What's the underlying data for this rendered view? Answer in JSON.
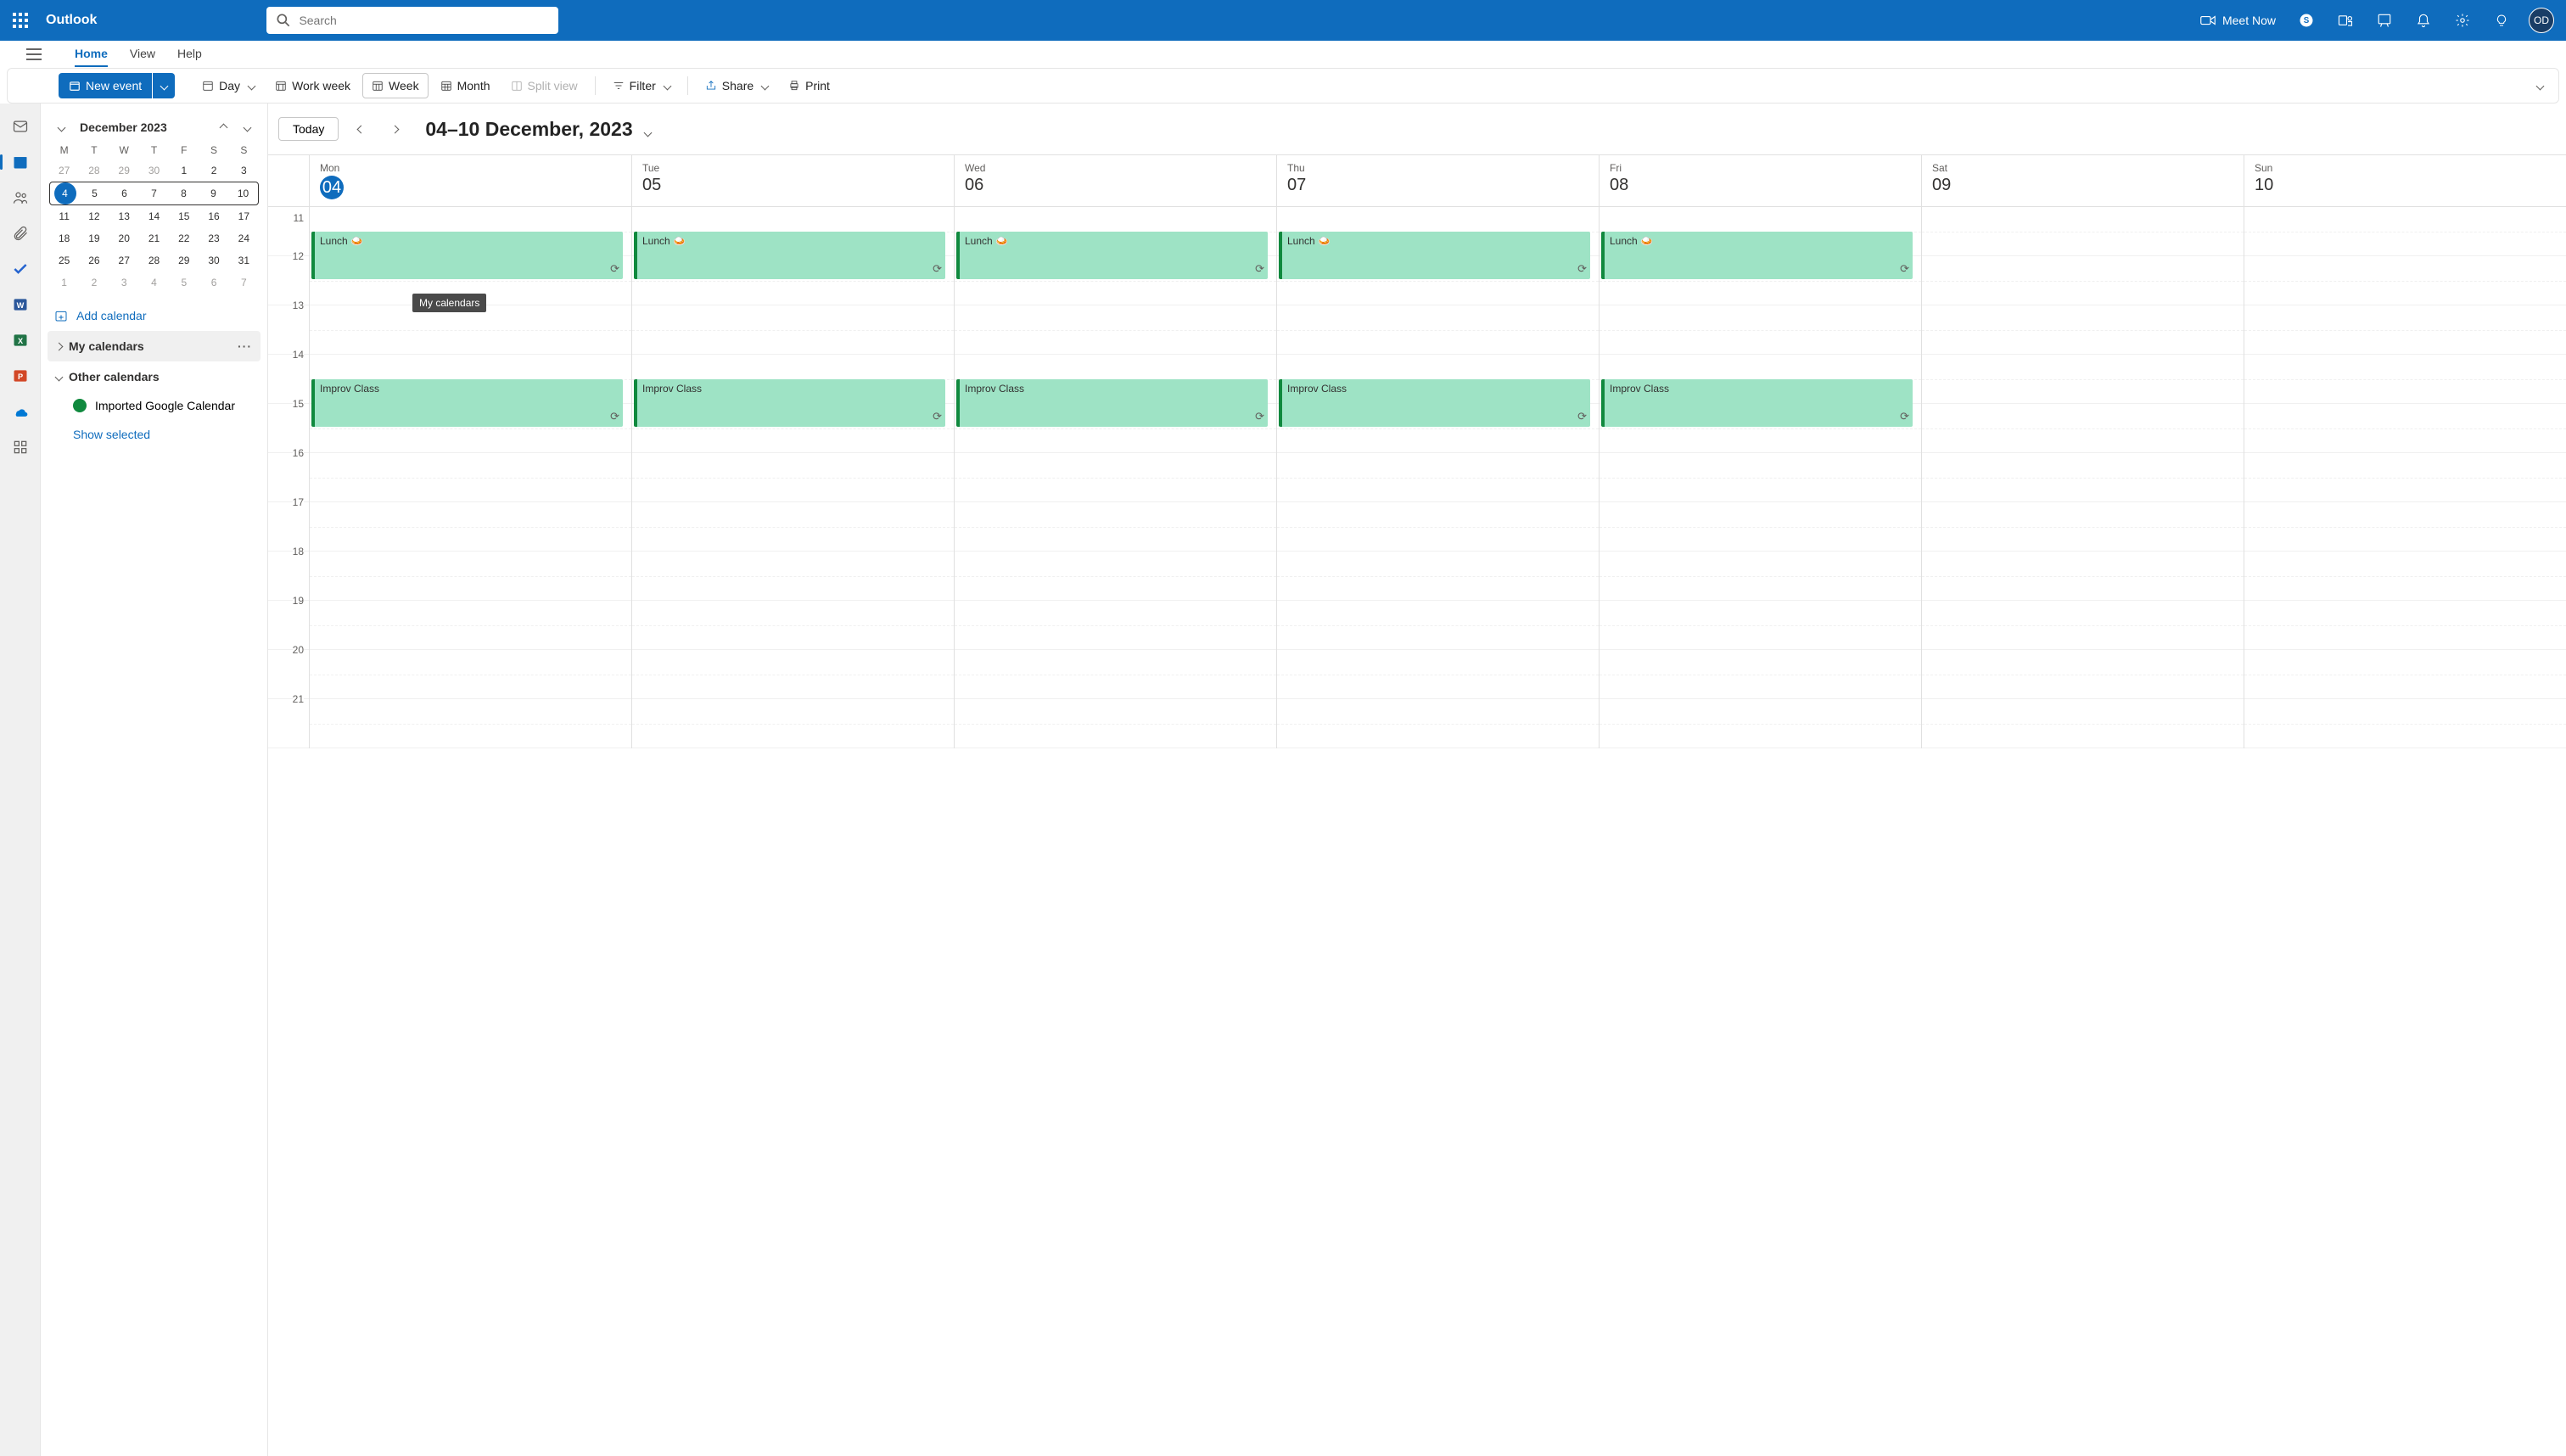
{
  "app_name": "Outlook",
  "search_placeholder": "Search",
  "meet_now": "Meet Now",
  "avatar_initials": "OD",
  "nav_tabs": [
    "Home",
    "View",
    "Help"
  ],
  "active_tab": 0,
  "ribbon": {
    "new_event": "New event",
    "day": "Day",
    "work_week": "Work week",
    "week": "Week",
    "month": "Month",
    "split_view": "Split view",
    "filter": "Filter",
    "share": "Share",
    "print": "Print"
  },
  "sidebar": {
    "month_title": "December 2023",
    "dow": [
      "M",
      "T",
      "W",
      "T",
      "F",
      "S",
      "S"
    ],
    "rows": [
      {
        "sel": false,
        "days": [
          {
            "n": "27",
            "o": true
          },
          {
            "n": "28",
            "o": true
          },
          {
            "n": "29",
            "o": true
          },
          {
            "n": "30",
            "o": true
          },
          {
            "n": "1"
          },
          {
            "n": "2"
          },
          {
            "n": "3"
          }
        ]
      },
      {
        "sel": true,
        "days": [
          {
            "n": "4",
            "today": true
          },
          {
            "n": "5"
          },
          {
            "n": "6"
          },
          {
            "n": "7"
          },
          {
            "n": "8"
          },
          {
            "n": "9"
          },
          {
            "n": "10"
          }
        ]
      },
      {
        "sel": false,
        "days": [
          {
            "n": "11"
          },
          {
            "n": "12"
          },
          {
            "n": "13"
          },
          {
            "n": "14"
          },
          {
            "n": "15"
          },
          {
            "n": "16"
          },
          {
            "n": "17"
          }
        ]
      },
      {
        "sel": false,
        "days": [
          {
            "n": "18"
          },
          {
            "n": "19"
          },
          {
            "n": "20"
          },
          {
            "n": "21"
          },
          {
            "n": "22"
          },
          {
            "n": "23"
          },
          {
            "n": "24"
          }
        ]
      },
      {
        "sel": false,
        "days": [
          {
            "n": "25"
          },
          {
            "n": "26"
          },
          {
            "n": "27"
          },
          {
            "n": "28"
          },
          {
            "n": "29"
          },
          {
            "n": "30"
          },
          {
            "n": "31"
          }
        ]
      },
      {
        "sel": false,
        "days": [
          {
            "n": "1",
            "o": true
          },
          {
            "n": "2",
            "o": true
          },
          {
            "n": "3",
            "o": true
          },
          {
            "n": "4",
            "o": true
          },
          {
            "n": "5",
            "o": true
          },
          {
            "n": "6",
            "o": true
          },
          {
            "n": "7",
            "o": true
          }
        ]
      }
    ],
    "add_calendar": "Add calendar",
    "my_calendars": "My calendars",
    "other_calendars": "Other calendars",
    "imported": "Imported Google Calendar",
    "show_selected": "Show selected",
    "tooltip": "My calendars"
  },
  "cal": {
    "today": "Today",
    "range": "04–10 December, 2023",
    "days": [
      {
        "name": "Mon",
        "num": "04",
        "today": true
      },
      {
        "name": "Tue",
        "num": "05"
      },
      {
        "name": "Wed",
        "num": "06"
      },
      {
        "name": "Thu",
        "num": "07"
      },
      {
        "name": "Fri",
        "num": "08"
      },
      {
        "name": "Sat",
        "num": "09"
      },
      {
        "name": "Sun",
        "num": "10"
      }
    ],
    "hours": [
      "11",
      "12",
      "13",
      "14",
      "15",
      "16",
      "17",
      "18",
      "19",
      "20",
      "21"
    ],
    "events": {
      "lunch": "Lunch 🍛",
      "improv": "Improv Class"
    }
  }
}
